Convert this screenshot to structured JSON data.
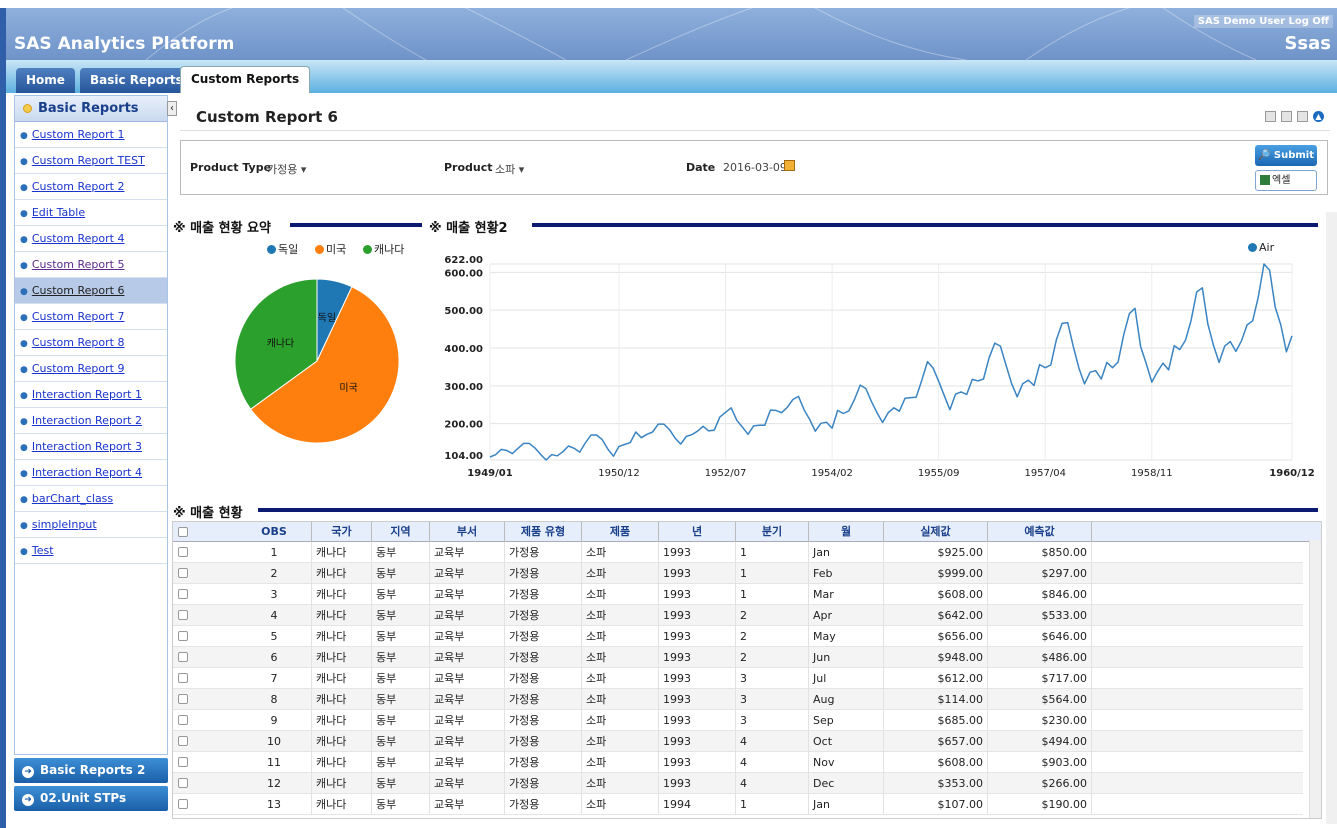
{
  "app": {
    "title": "SAS Analytics Platform",
    "logoff": "SAS Demo User Log Off",
    "logo": "Ssas",
    "brand_color": "#2e5fa8"
  },
  "tabs": [
    {
      "label": "Home",
      "active": false
    },
    {
      "label": "Basic Reports",
      "active": false
    },
    {
      "label": "Custom Reports",
      "active": true
    }
  ],
  "sidebar": {
    "header": "Basic Reports",
    "items": [
      {
        "label": "Custom Report 1",
        "state": "normal"
      },
      {
        "label": "Custom Report TEST",
        "state": "normal"
      },
      {
        "label": "Custom Report 2",
        "state": "normal"
      },
      {
        "label": "Edit Table",
        "state": "normal"
      },
      {
        "label": "Custom Report 4",
        "state": "normal"
      },
      {
        "label": "Custom Report 5",
        "state": "visited"
      },
      {
        "label": "Custom Report 6",
        "state": "selected"
      },
      {
        "label": "Custom Report 7",
        "state": "normal"
      },
      {
        "label": "Custom Report 8",
        "state": "normal"
      },
      {
        "label": "Custom Report 9",
        "state": "normal"
      },
      {
        "label": "Interaction Report 1",
        "state": "normal"
      },
      {
        "label": "Interaction Report 2",
        "state": "normal"
      },
      {
        "label": "Interaction Report 3",
        "state": "normal"
      },
      {
        "label": "Interaction Report 4",
        "state": "normal"
      },
      {
        "label": "barChart_class",
        "state": "normal"
      },
      {
        "label": "simpleInput",
        "state": "normal"
      },
      {
        "label": "Test",
        "state": "normal"
      }
    ],
    "bottom_buttons": [
      "Basic Reports 2",
      "02.Unit STPs"
    ]
  },
  "report": {
    "title": "Custom Report 6"
  },
  "filters": {
    "product_type_label": "Product Type",
    "product_type_value": "가정용 ▾",
    "product_label": "Product",
    "product_value": "소파 ▾",
    "date_label": "Date",
    "date_value": "2016-03-09",
    "submit_label": "Submit",
    "excel_label": "엑셀"
  },
  "sections": {
    "pie_title": "※ 매출 현황 요약",
    "line_title": "※ 매출 현황2",
    "table_title": "※ 매출 현황"
  },
  "chart_data": [
    {
      "type": "pie",
      "title": "※ 매출 현황 요약",
      "legend": [
        "독일",
        "미국",
        "캐나다"
      ],
      "colors": [
        "#1f77b4",
        "#ff7f0e",
        "#2ca02c"
      ],
      "slices": [
        {
          "label": "독일",
          "value": 7
        },
        {
          "label": "미국",
          "value": 58
        },
        {
          "label": "캐나다",
          "value": 35
        }
      ]
    },
    {
      "type": "line",
      "title": "※ 매출 현황2",
      "series_name": "Air",
      "color": "#3a84c2",
      "ylim": [
        104,
        622
      ],
      "y_ticks": [
        "622.00",
        "600.00",
        "500.00",
        "400.00",
        "300.00",
        "200.00",
        "104.00"
      ],
      "x_ticks": [
        "1949/01",
        "1950/12",
        "1952/07",
        "1954/02",
        "1955/09",
        "1957/04",
        "1958/11",
        "1960/12"
      ],
      "x": [
        "1949/01",
        "1949/02",
        "1949/03",
        "1949/04",
        "1949/05",
        "1949/06",
        "1949/07",
        "1949/08",
        "1949/09",
        "1949/10",
        "1949/11",
        "1949/12",
        "1950/01",
        "1950/02",
        "1950/03",
        "1950/04",
        "1950/05",
        "1950/06",
        "1950/07",
        "1950/08",
        "1950/09",
        "1950/10",
        "1950/11",
        "1950/12",
        "1951/01",
        "1951/02",
        "1951/03",
        "1951/04",
        "1951/05",
        "1951/06",
        "1951/07",
        "1951/08",
        "1951/09",
        "1951/10",
        "1951/11",
        "1951/12",
        "1952/01",
        "1952/02",
        "1952/03",
        "1952/04",
        "1952/05",
        "1952/06",
        "1952/07",
        "1952/08",
        "1952/09",
        "1952/10",
        "1952/11",
        "1952/12",
        "1953/01",
        "1953/02",
        "1953/03",
        "1953/04",
        "1953/05",
        "1953/06",
        "1953/07",
        "1953/08",
        "1953/09",
        "1953/10",
        "1953/11",
        "1953/12",
        "1954/01",
        "1954/02",
        "1954/03",
        "1954/04",
        "1954/05",
        "1954/06",
        "1954/07",
        "1954/08",
        "1954/09",
        "1954/10",
        "1954/11",
        "1954/12",
        "1955/01",
        "1955/02",
        "1955/03",
        "1955/04",
        "1955/05",
        "1955/06",
        "1955/07",
        "1955/08",
        "1955/09",
        "1955/10",
        "1955/11",
        "1955/12",
        "1956/01",
        "1956/02",
        "1956/03",
        "1956/04",
        "1956/05",
        "1956/06",
        "1956/07",
        "1956/08",
        "1956/09",
        "1956/10",
        "1956/11",
        "1956/12",
        "1957/01",
        "1957/02",
        "1957/03",
        "1957/04",
        "1957/05",
        "1957/06",
        "1957/07",
        "1957/08",
        "1957/09",
        "1957/10",
        "1957/11",
        "1957/12",
        "1958/01",
        "1958/02",
        "1958/03",
        "1958/04",
        "1958/05",
        "1958/06",
        "1958/07",
        "1958/08",
        "1958/09",
        "1958/10",
        "1958/11",
        "1958/12",
        "1959/01",
        "1959/02",
        "1959/03",
        "1959/04",
        "1959/05",
        "1959/06",
        "1959/07",
        "1959/08",
        "1959/09",
        "1959/10",
        "1959/11",
        "1959/12",
        "1960/01",
        "1960/02",
        "1960/03",
        "1960/04",
        "1960/05",
        "1960/06",
        "1960/07",
        "1960/08",
        "1960/09",
        "1960/10",
        "1960/11",
        "1960/12"
      ],
      "values": [
        112,
        118,
        132,
        129,
        121,
        135,
        148,
        148,
        136,
        119,
        104,
        118,
        115,
        126,
        141,
        135,
        125,
        149,
        170,
        170,
        158,
        133,
        114,
        140,
        145,
        150,
        178,
        163,
        172,
        178,
        199,
        199,
        184,
        162,
        146,
        166,
        171,
        180,
        193,
        181,
        183,
        218,
        230,
        242,
        209,
        191,
        172,
        194,
        196,
        196,
        236,
        235,
        229,
        243,
        264,
        272,
        237,
        211,
        180,
        201,
        204,
        188,
        235,
        227,
        234,
        264,
        302,
        293,
        259,
        229,
        203,
        229,
        242,
        233,
        267,
        269,
        270,
        315,
        364,
        347,
        312,
        274,
        237,
        278,
        284,
        277,
        317,
        313,
        318,
        374,
        413,
        405,
        355,
        306,
        271,
        306,
        315,
        301,
        356,
        348,
        355,
        422,
        465,
        467,
        404,
        347,
        305,
        336,
        340,
        318,
        362,
        348,
        363,
        435,
        491,
        505,
        404,
        359,
        310,
        337,
        360,
        342,
        406,
        396,
        420,
        472,
        548,
        559,
        463,
        407,
        362,
        405,
        417,
        391,
        419,
        461,
        472,
        535,
        622,
        606,
        508,
        461,
        390,
        432
      ]
    }
  ],
  "table": {
    "columns": [
      "OBS",
      "국가",
      "지역",
      "부서",
      "제품 유형",
      "제품",
      "년",
      "분기",
      "월",
      "실제값",
      "예측값"
    ],
    "rows": [
      [
        "1",
        "캐나다",
        "동부",
        "교육부",
        "가정용",
        "소파",
        "1993",
        "1",
        "Jan",
        "$925.00",
        "$850.00"
      ],
      [
        "2",
        "캐나다",
        "동부",
        "교육부",
        "가정용",
        "소파",
        "1993",
        "1",
        "Feb",
        "$999.00",
        "$297.00"
      ],
      [
        "3",
        "캐나다",
        "동부",
        "교육부",
        "가정용",
        "소파",
        "1993",
        "1",
        "Mar",
        "$608.00",
        "$846.00"
      ],
      [
        "4",
        "캐나다",
        "동부",
        "교육부",
        "가정용",
        "소파",
        "1993",
        "2",
        "Apr",
        "$642.00",
        "$533.00"
      ],
      [
        "5",
        "캐나다",
        "동부",
        "교육부",
        "가정용",
        "소파",
        "1993",
        "2",
        "May",
        "$656.00",
        "$646.00"
      ],
      [
        "6",
        "캐나다",
        "동부",
        "교육부",
        "가정용",
        "소파",
        "1993",
        "2",
        "Jun",
        "$948.00",
        "$486.00"
      ],
      [
        "7",
        "캐나다",
        "동부",
        "교육부",
        "가정용",
        "소파",
        "1993",
        "3",
        "Jul",
        "$612.00",
        "$717.00"
      ],
      [
        "8",
        "캐나다",
        "동부",
        "교육부",
        "가정용",
        "소파",
        "1993",
        "3",
        "Aug",
        "$114.00",
        "$564.00"
      ],
      [
        "9",
        "캐나다",
        "동부",
        "교육부",
        "가정용",
        "소파",
        "1993",
        "3",
        "Sep",
        "$685.00",
        "$230.00"
      ],
      [
        "10",
        "캐나다",
        "동부",
        "교육부",
        "가정용",
        "소파",
        "1993",
        "4",
        "Oct",
        "$657.00",
        "$494.00"
      ],
      [
        "11",
        "캐나다",
        "동부",
        "교육부",
        "가정용",
        "소파",
        "1993",
        "4",
        "Nov",
        "$608.00",
        "$903.00"
      ],
      [
        "12",
        "캐나다",
        "동부",
        "교육부",
        "가정용",
        "소파",
        "1993",
        "4",
        "Dec",
        "$353.00",
        "$266.00"
      ],
      [
        "13",
        "캐나다",
        "동부",
        "교육부",
        "가정용",
        "소파",
        "1994",
        "1",
        "Jan",
        "$107.00",
        "$190.00"
      ]
    ]
  }
}
